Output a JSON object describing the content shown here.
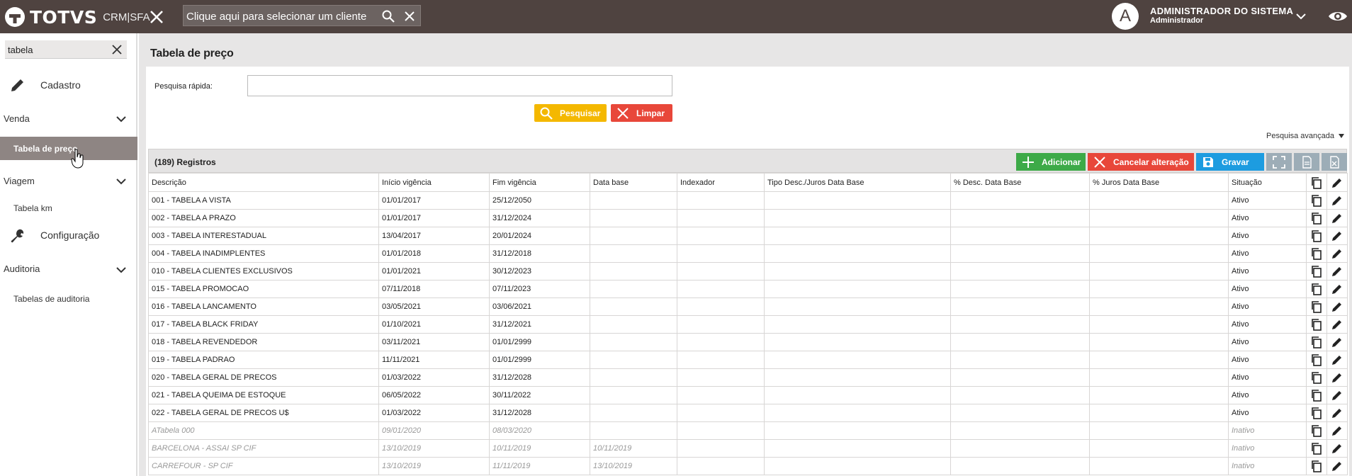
{
  "topbar": {
    "brand": "TOTVS",
    "product": "CRM|SFA",
    "client_placeholder": "Clique aqui para selecionar um cliente",
    "avatar_letter": "A",
    "user_name": "ADMINISTRADOR DO SISTEMA",
    "user_role": "Administrador"
  },
  "sidebar": {
    "search_value": "tabela",
    "cadastro": "Cadastro",
    "venda": "Venda",
    "tabela_preco": "Tabela de preço",
    "viagem": "Viagem",
    "tabela_km": "Tabela km",
    "configuracao": "Configuração",
    "auditoria": "Auditoria",
    "tabelas_auditoria": "Tabelas de auditoria"
  },
  "main": {
    "title": "Tabela de preço",
    "quick_search_label": "Pesquisa rápida:",
    "search_btn": "Pesquisar",
    "clear_btn": "Limpar",
    "advanced_search": "Pesquisa avançada",
    "records": "(189) Registros",
    "add_btn": "Adicionar",
    "cancel_btn": "Cancelar alteração",
    "save_btn": "Gravar"
  },
  "table": {
    "headers": [
      "Descrição",
      "Início vigência",
      "Fim vigência",
      "Data base",
      "Indexador",
      "Tipo Desc./Juros Data Base",
      "% Desc. Data Base",
      "% Juros Data Base",
      "Situação"
    ],
    "rows": [
      [
        "001 - TABELA A VISTA",
        "01/01/2017",
        "25/12/2050",
        "",
        "",
        "",
        "",
        "",
        "Ativo"
      ],
      [
        "002 - TABELA A PRAZO",
        "01/01/2017",
        "31/12/2024",
        "",
        "",
        "",
        "",
        "",
        "Ativo"
      ],
      [
        "003 - TABELA INTERESTADUAL",
        "13/04/2017",
        "20/01/2024",
        "",
        "",
        "",
        "",
        "",
        "Ativo"
      ],
      [
        "004 - TABELA INADIMPLENTES",
        "01/01/2018",
        "31/12/2018",
        "",
        "",
        "",
        "",
        "",
        "Ativo"
      ],
      [
        "010 - TABELA CLIENTES EXCLUSIVOS",
        "01/01/2021",
        "30/12/2023",
        "",
        "",
        "",
        "",
        "",
        "Ativo"
      ],
      [
        "015 - TABELA PROMOCAO",
        "07/11/2018",
        "07/11/2023",
        "",
        "",
        "",
        "",
        "",
        "Ativo"
      ],
      [
        "016 - TABELA LANCAMENTO",
        "03/05/2021",
        "03/06/2021",
        "",
        "",
        "",
        "",
        "",
        "Ativo"
      ],
      [
        "017 - TABELA BLACK FRIDAY",
        "01/10/2021",
        "31/12/2021",
        "",
        "",
        "",
        "",
        "",
        "Ativo"
      ],
      [
        "018 - TABELA REVENDEDOR",
        "03/11/2021",
        "01/01/2999",
        "",
        "",
        "",
        "",
        "",
        "Ativo"
      ],
      [
        "019 - TABELA PADRAO",
        "11/11/2021",
        "01/01/2999",
        "",
        "",
        "",
        "",
        "",
        "Ativo"
      ],
      [
        "020 - TABELA GERAL DE PRECOS",
        "01/03/2022",
        "31/12/2028",
        "",
        "",
        "",
        "",
        "",
        "Ativo"
      ],
      [
        "021 - TABELA QUEIMA DE ESTOQUE",
        "06/05/2022",
        "30/11/2022",
        "",
        "",
        "",
        "",
        "",
        "Ativo"
      ],
      [
        "022 - TABELA GERAL DE PRECOS U$",
        "01/03/2022",
        "31/12/2028",
        "",
        "",
        "",
        "",
        "",
        "Ativo"
      ],
      [
        "ATabela 000",
        "09/01/2020",
        "08/03/2020",
        "",
        "",
        "",
        "",
        "",
        "Inativo"
      ],
      [
        "BARCELONA - ASSAI SP CIF",
        "13/10/2019",
        "10/11/2019",
        "10/11/2019",
        "",
        "",
        "",
        "",
        "Inativo"
      ],
      [
        "CARREFOUR - SP CIF",
        "13/10/2019",
        "11/11/2019",
        "13/10/2019",
        "",
        "",
        "",
        "",
        "Inativo"
      ]
    ]
  },
  "colors": {
    "topbar": "#4f4340",
    "add": "#3daa48",
    "cancel": "#e8473a",
    "save": "#1d9ce0",
    "search": "#f4b800"
  },
  "icons": [
    "x-close-icon",
    "search-icon",
    "chevron-down-icon",
    "eye-icon",
    "pencil-icon",
    "wrench-icon",
    "plus-icon",
    "save-icon",
    "expand-icon",
    "copy-icon",
    "edit-icon"
  ]
}
